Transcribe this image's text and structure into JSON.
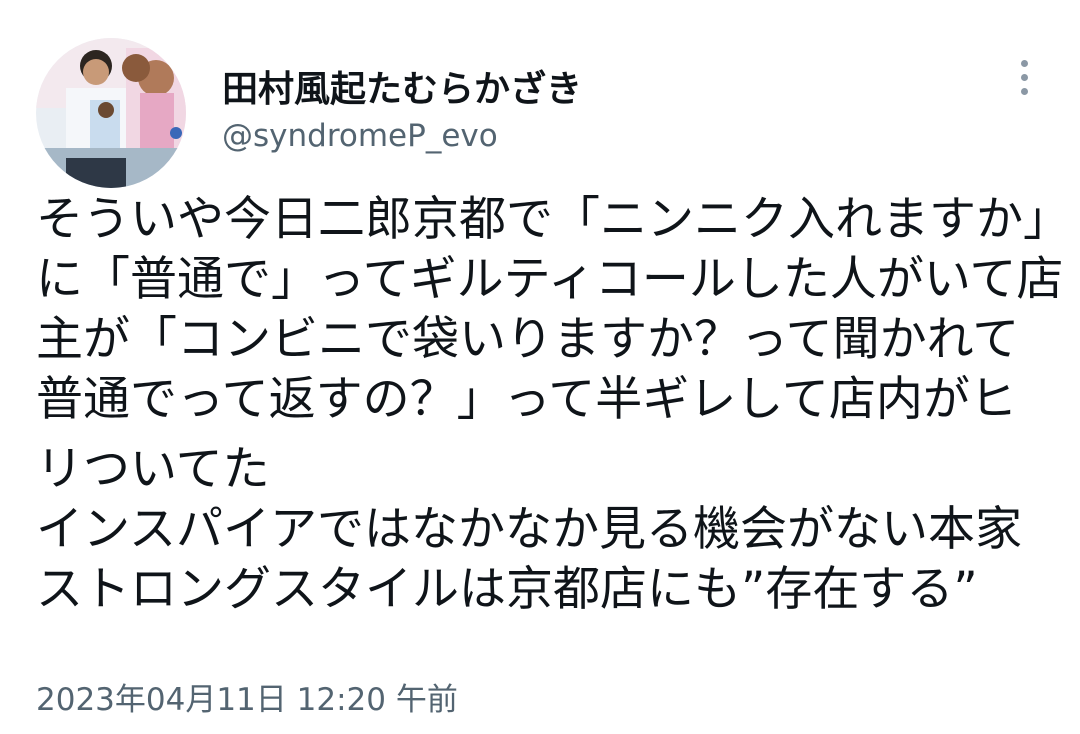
{
  "author": {
    "display_name": "田村風起たむらかざき",
    "handle": "@syndromeP_evo",
    "avatar": "profile-photo"
  },
  "menu": {
    "icon": "more-vertical-icon"
  },
  "tweet": {
    "lines": [
      "そういや今日二郎京都で「ニンニク入れますか」",
      "に「普通で」ってギルティコールした人がいて店",
      "主が「コンビニで袋いりますか？って聞かれて",
      "普通でって返すの？」って半ギレして店内がヒ",
      "リついてた",
      "インスパイアではなかなか見る機会がない本家",
      "ストロングスタイルは京都店にも”存在する”"
    ]
  },
  "timestamp": "2023年04月11日 12:20 午前"
}
